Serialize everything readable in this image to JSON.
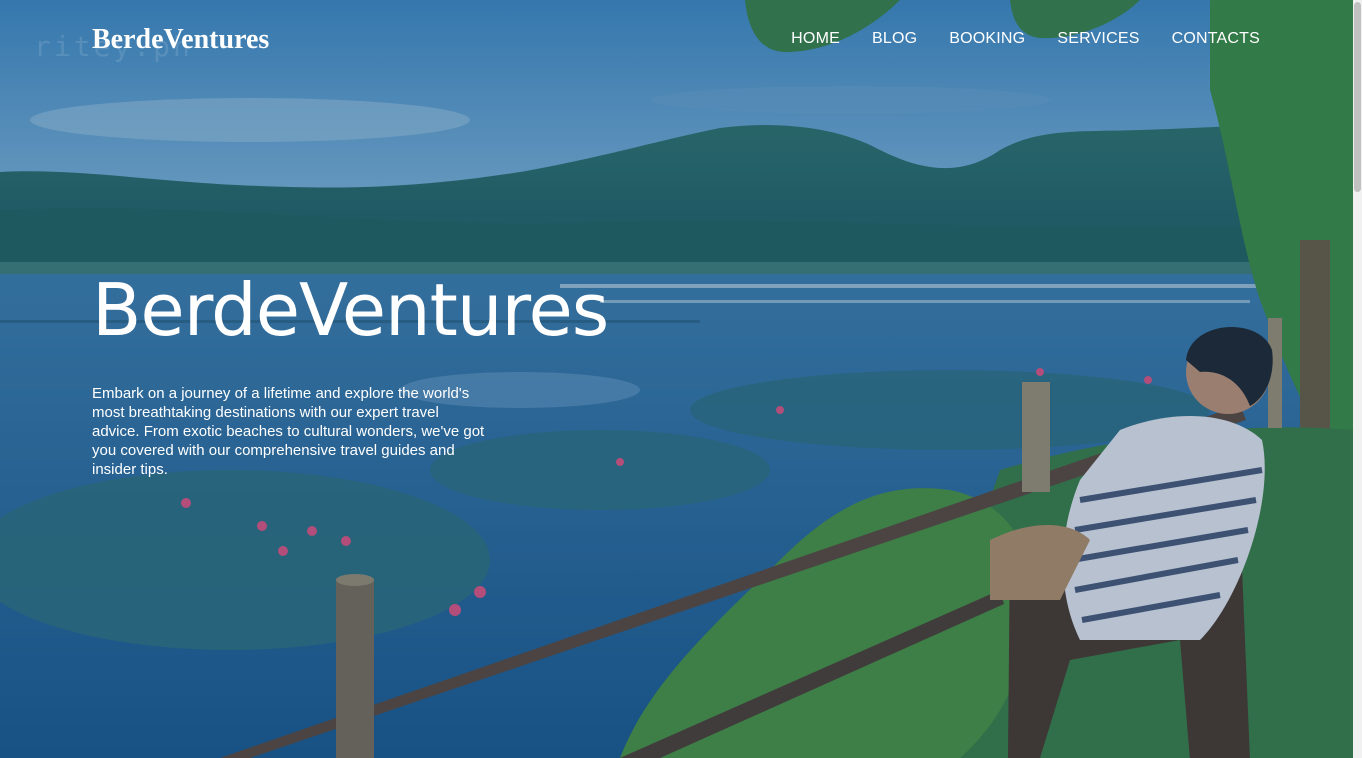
{
  "site": {
    "logo": "BerdeVentures",
    "watermark": "ritey.ph"
  },
  "nav": {
    "items": [
      {
        "label": "HOME"
      },
      {
        "label": "BLOG"
      },
      {
        "label": "BOOKING"
      },
      {
        "label": "SERVICES"
      },
      {
        "label": "CONTACTS"
      }
    ]
  },
  "hero": {
    "title": "BerdeVentures",
    "description": "Embark on a journey of a lifetime and explore the world's most breathtaking destinations with our expert travel advice. From exotic beaches to cultural wonders, we've got you covered with our comprehensive travel guides and insider tips.",
    "image_subject": "man in striped shirt seated on chair overlooking lily-pad lake with mountains",
    "overlay_color": "#14467a"
  }
}
